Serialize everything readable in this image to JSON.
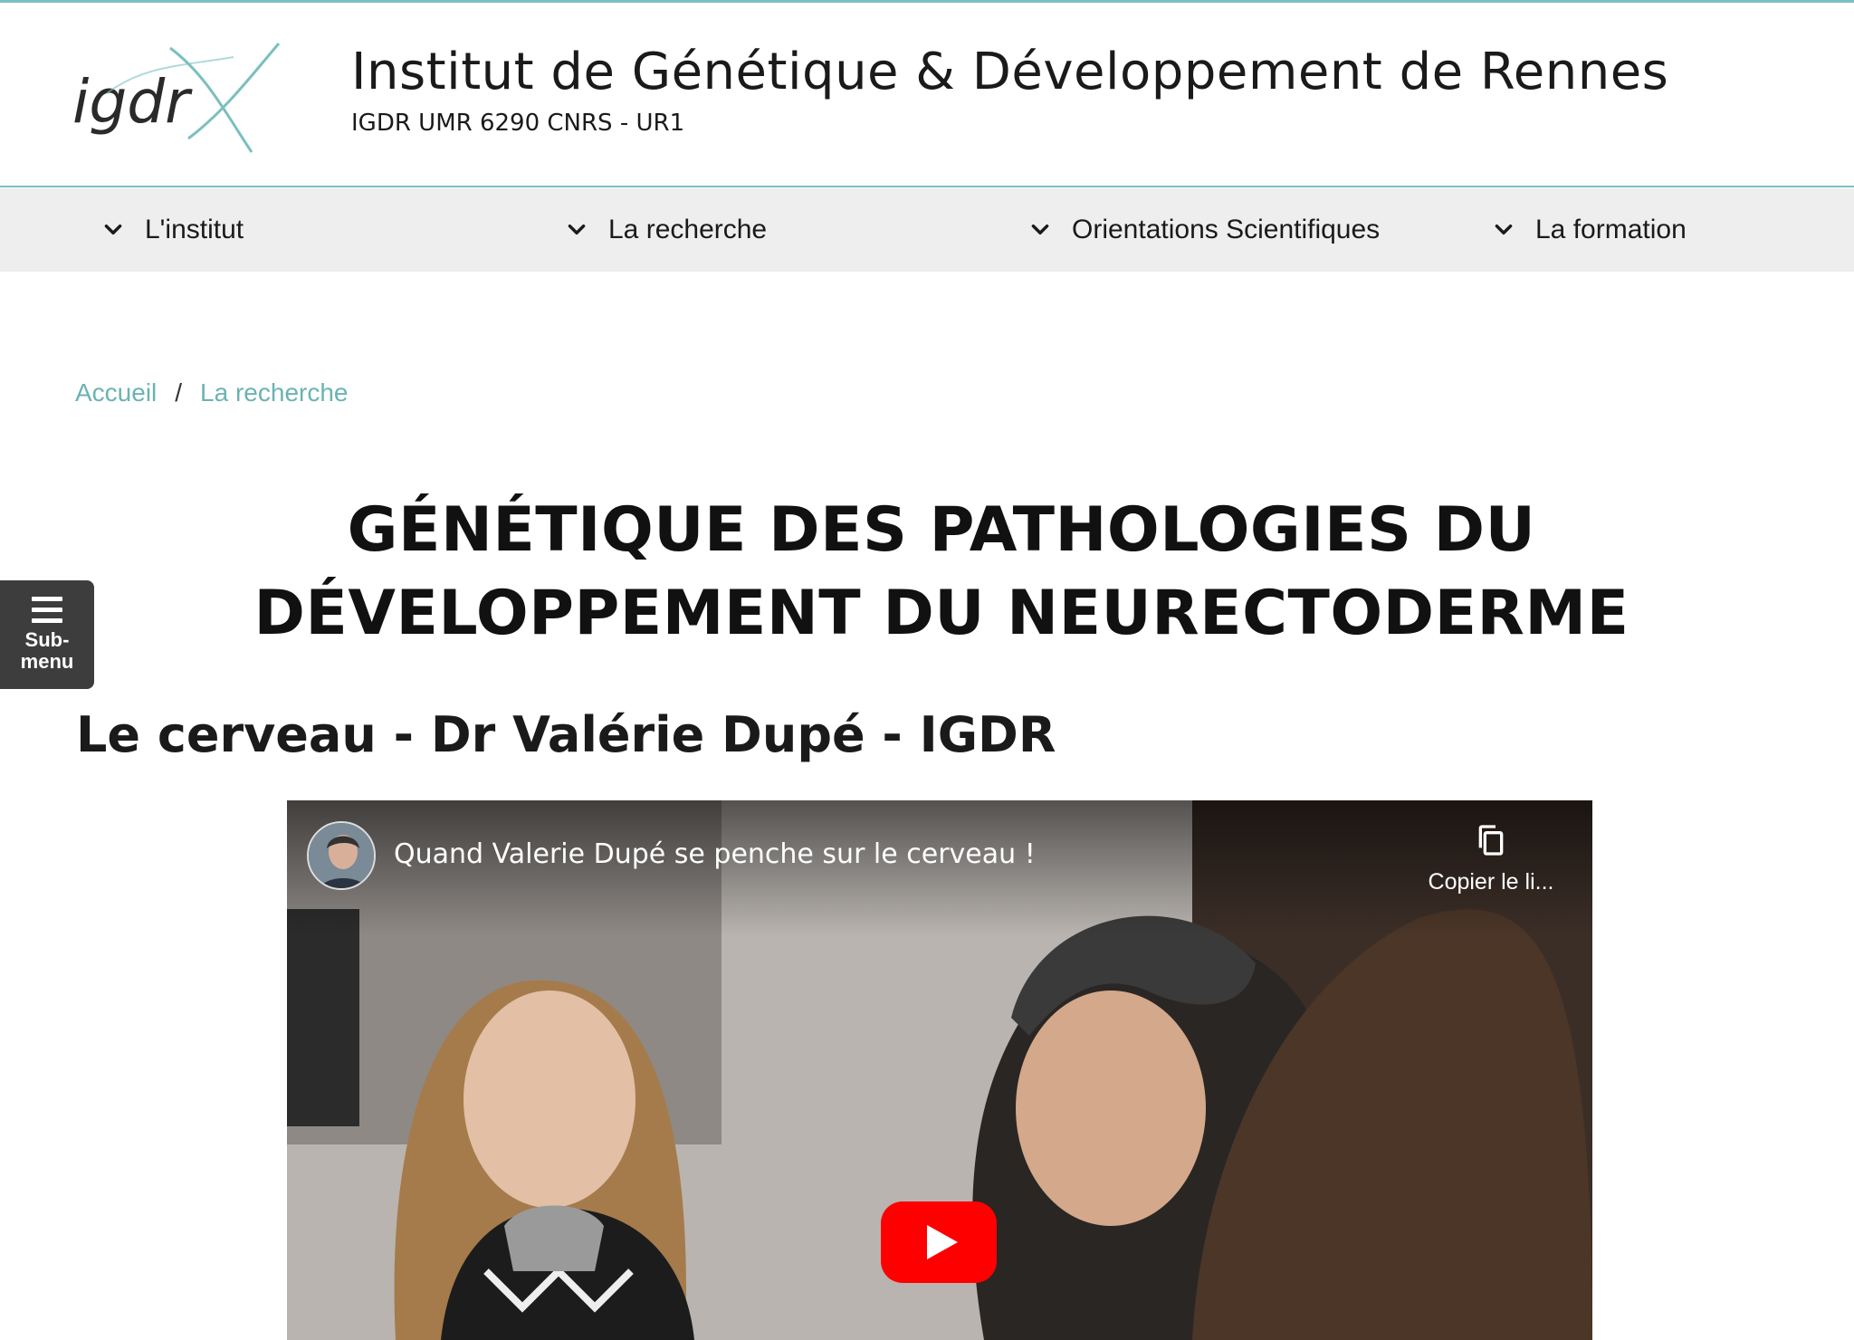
{
  "header": {
    "logo_text": "igdrX",
    "title": "Institut de Génétique & Développement de Rennes",
    "subtitle": "IGDR UMR 6290 CNRS - UR1"
  },
  "nav": {
    "items": [
      {
        "label": "L'institut",
        "icon": "chevron-down-icon"
      },
      {
        "label": "La recherche",
        "icon": "chevron-down-icon"
      },
      {
        "label": "Orientations Scientifiques",
        "icon": "chevron-down-icon"
      },
      {
        "label": "La formation",
        "icon": "chevron-down-icon"
      }
    ]
  },
  "breadcrumb": {
    "items": [
      "Accueil",
      "La recherche"
    ],
    "separator": "/"
  },
  "page": {
    "title": "GÉNÉTIQUE DES PATHOLOGIES DU DÉVELOPPEMENT DU NEURECTODERME",
    "section_heading": "Le cerveau - Dr Valérie Dupé - IGDR"
  },
  "submenu": {
    "label": "Sub-menu",
    "icon": "hamburger-icon"
  },
  "video": {
    "title": "Quand Valerie Dupé se penche sur le cerveau !",
    "copy_link_label": "Copier le li...",
    "copy_icon": "copy-icon",
    "play_icon": "youtube-play-icon"
  },
  "colors": {
    "accent": "#7cbfbf",
    "link": "#6bb3b3",
    "nav_bg": "#eeeeee",
    "submenu_bg": "#3d3d3d",
    "youtube_red": "#ff0000"
  }
}
